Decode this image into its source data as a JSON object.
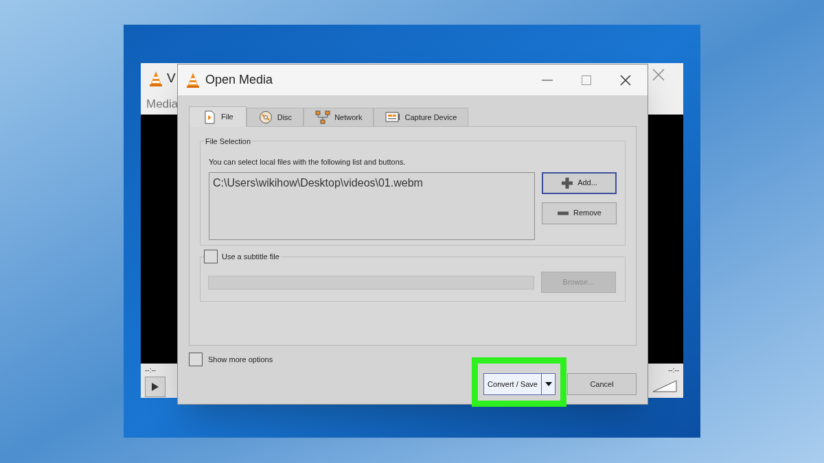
{
  "background_window": {
    "title": "V",
    "menu": "Media",
    "time_left": "--:--",
    "time_right": "--:--"
  },
  "dialog": {
    "title": "Open Media"
  },
  "tabs": [
    {
      "label": "File",
      "selected": true,
      "kind": "file"
    },
    {
      "label": "Disc",
      "selected": false,
      "kind": "disc"
    },
    {
      "label": "Network",
      "selected": false,
      "kind": "network"
    },
    {
      "label": "Capture Device",
      "selected": false,
      "kind": "capture"
    }
  ],
  "file_selection": {
    "legend": "File Selection",
    "hint": "You can select local files with the following list and buttons.",
    "files": [
      "C:\\Users\\wikihow\\Desktop\\videos\\01.webm"
    ],
    "add_button": "Add...",
    "remove_button": "Remove"
  },
  "subtitle": {
    "label": "Use a subtitle file",
    "checked": false,
    "browse_button": "Browse...",
    "disabled": true
  },
  "show_more_options": {
    "label": "Show more options",
    "checked": false
  },
  "convert_button": {
    "label": "Convert / Save",
    "highlighted": true
  },
  "cancel_button": "Cancel"
}
